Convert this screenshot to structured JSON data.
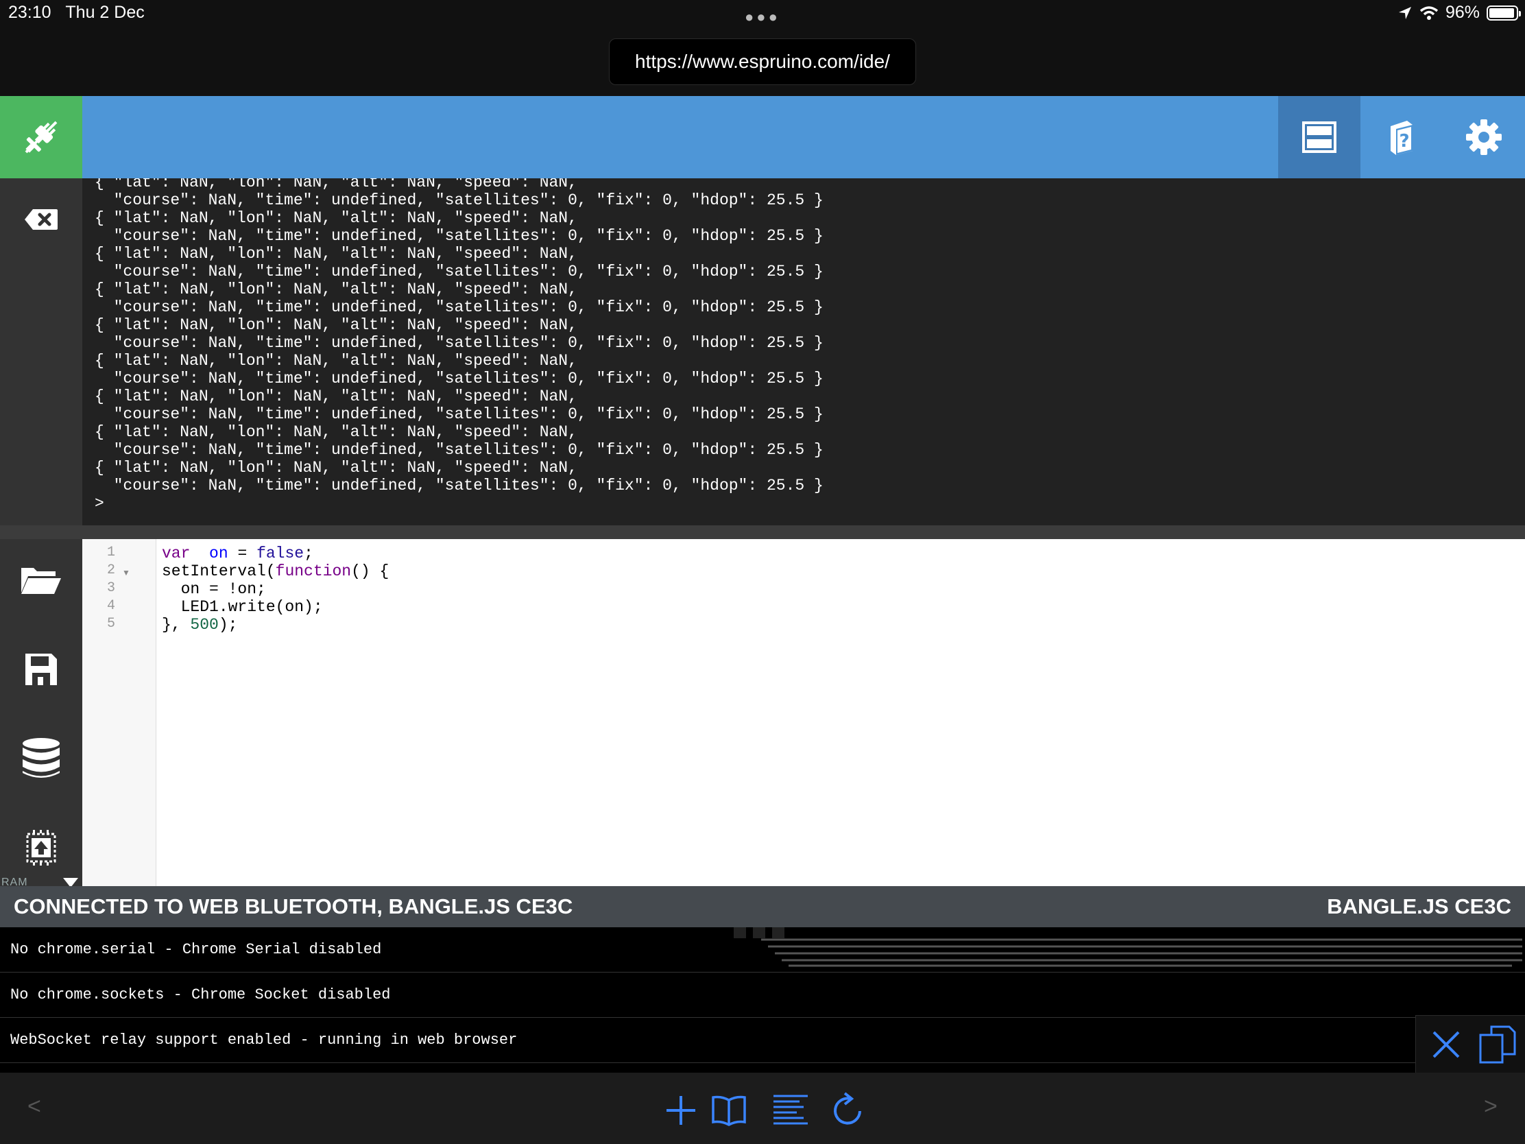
{
  "status_bar": {
    "time": "23:10",
    "date": "Thu 2 Dec",
    "battery_text": "96%",
    "battery_level": 0.96
  },
  "browser": {
    "url": "https://www.espruino.com/ide/"
  },
  "ide": {
    "accent_color": "#4e96d7",
    "connected_color": "#4cb760"
  },
  "terminal": {
    "lines": [
      "{ \"lat\": NaN, \"lon\": NaN, \"alt\": NaN, \"speed\": NaN,",
      "  \"course\": NaN, \"time\": undefined, \"satellites\": 0, \"fix\": 0, \"hdop\": 25.5 }",
      "{ \"lat\": NaN, \"lon\": NaN, \"alt\": NaN, \"speed\": NaN,",
      "  \"course\": NaN, \"time\": undefined, \"satellites\": 0, \"fix\": 0, \"hdop\": 25.5 }",
      "{ \"lat\": NaN, \"lon\": NaN, \"alt\": NaN, \"speed\": NaN,",
      "  \"course\": NaN, \"time\": undefined, \"satellites\": 0, \"fix\": 0, \"hdop\": 25.5 }",
      "{ \"lat\": NaN, \"lon\": NaN, \"alt\": NaN, \"speed\": NaN,",
      "  \"course\": NaN, \"time\": undefined, \"satellites\": 0, \"fix\": 0, \"hdop\": 25.5 }",
      "{ \"lat\": NaN, \"lon\": NaN, \"alt\": NaN, \"speed\": NaN,",
      "  \"course\": NaN, \"time\": undefined, \"satellites\": 0, \"fix\": 0, \"hdop\": 25.5 }",
      "{ \"lat\": NaN, \"lon\": NaN, \"alt\": NaN, \"speed\": NaN,",
      "  \"course\": NaN, \"time\": undefined, \"satellites\": 0, \"fix\": 0, \"hdop\": 25.5 }",
      "{ \"lat\": NaN, \"lon\": NaN, \"alt\": NaN, \"speed\": NaN,",
      "  \"course\": NaN, \"time\": undefined, \"satellites\": 0, \"fix\": 0, \"hdop\": 25.5 }",
      "{ \"lat\": NaN, \"lon\": NaN, \"alt\": NaN, \"speed\": NaN,",
      "  \"course\": NaN, \"time\": undefined, \"satellites\": 0, \"fix\": 0, \"hdop\": 25.5 }",
      "{ \"lat\": NaN, \"lon\": NaN, \"alt\": NaN, \"speed\": NaN,",
      "  \"course\": NaN, \"time\": undefined, \"satellites\": 0, \"fix\": 0, \"hdop\": 25.5 }",
      ">"
    ]
  },
  "editor": {
    "line_numbers": [
      "1",
      "2",
      "3",
      "4",
      "5"
    ],
    "code": {
      "l1_kw": "var",
      "l1_var": "on",
      "l1_eq": " = ",
      "l1_val": "false",
      "l1_end": ";",
      "l2_a": "setInterval(",
      "l2_kw": "function",
      "l2_b": "() {",
      "l3": "  on = !on;",
      "l4": "  LED1.write(on);",
      "l5_a": "}, ",
      "l5_num": "500",
      "l5_b": ");"
    }
  },
  "sidebar": {
    "ram_label": "RAM"
  },
  "connection": {
    "status": "CONNECTED TO WEB BLUETOOTH, BANGLE.JS CE3C",
    "device": "BANGLE.JS CE3C"
  },
  "notifications": [
    "No chrome.serial - Chrome Serial disabled",
    "No chrome.sockets - Chrome Socket disabled",
    "WebSocket relay support enabled - running in web browser"
  ],
  "icons": {
    "connect": "plug-disconnected-icon",
    "layout": "layout-split-icon",
    "help": "help-book-icon",
    "settings": "gear-icon",
    "clear": "backspace-clear-icon",
    "open": "folder-open-icon",
    "save": "floppy-save-icon",
    "storage": "database-icon",
    "upload": "upload-chip-icon"
  }
}
